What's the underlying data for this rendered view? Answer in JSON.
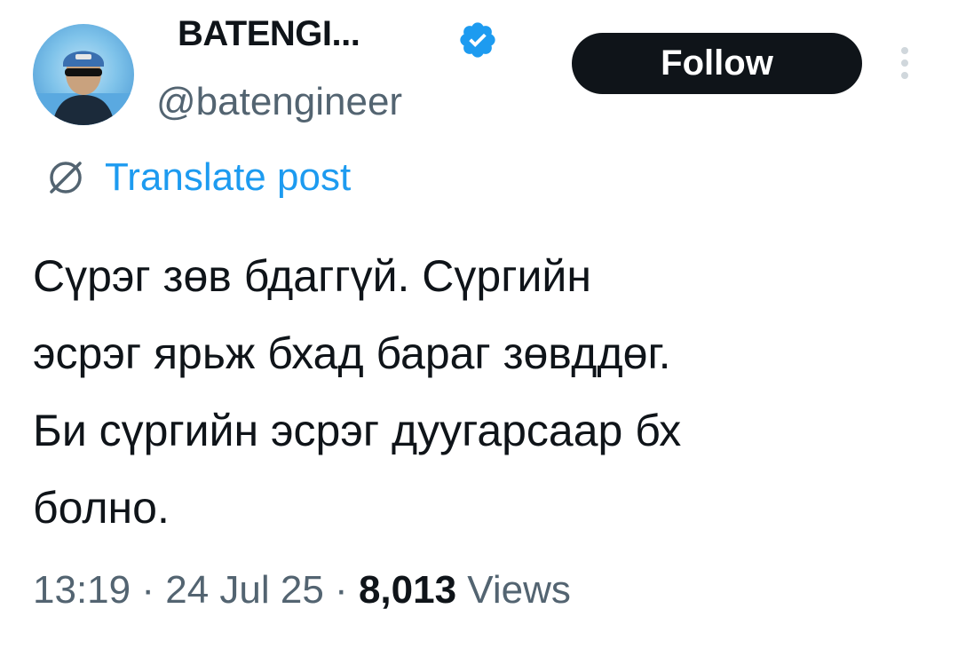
{
  "author": {
    "display_name": "BATENGI...",
    "handle": "@batengineer",
    "verified": true,
    "verified_color": "#1d9bf0"
  },
  "follow_button": {
    "label": "Follow"
  },
  "translate": {
    "label": "Translate post",
    "icon": "globe-icon"
  },
  "post": {
    "lines": [
      "Сүрэг зөв бдаггүй. Сүргийн",
      "эсрэг ярьж бхад бараг зөвддөг.",
      "Би сүргийн эсрэг дуугарсаар бх",
      "болно."
    ]
  },
  "meta": {
    "time": "13:19",
    "separator": "·",
    "date": "24 Jul 25",
    "views_count": "8,013",
    "views_label": "Views"
  },
  "colors": {
    "text": "#0f1419",
    "secondary": "#536471",
    "link": "#1d9bf0",
    "button_bg": "#0f1419"
  }
}
